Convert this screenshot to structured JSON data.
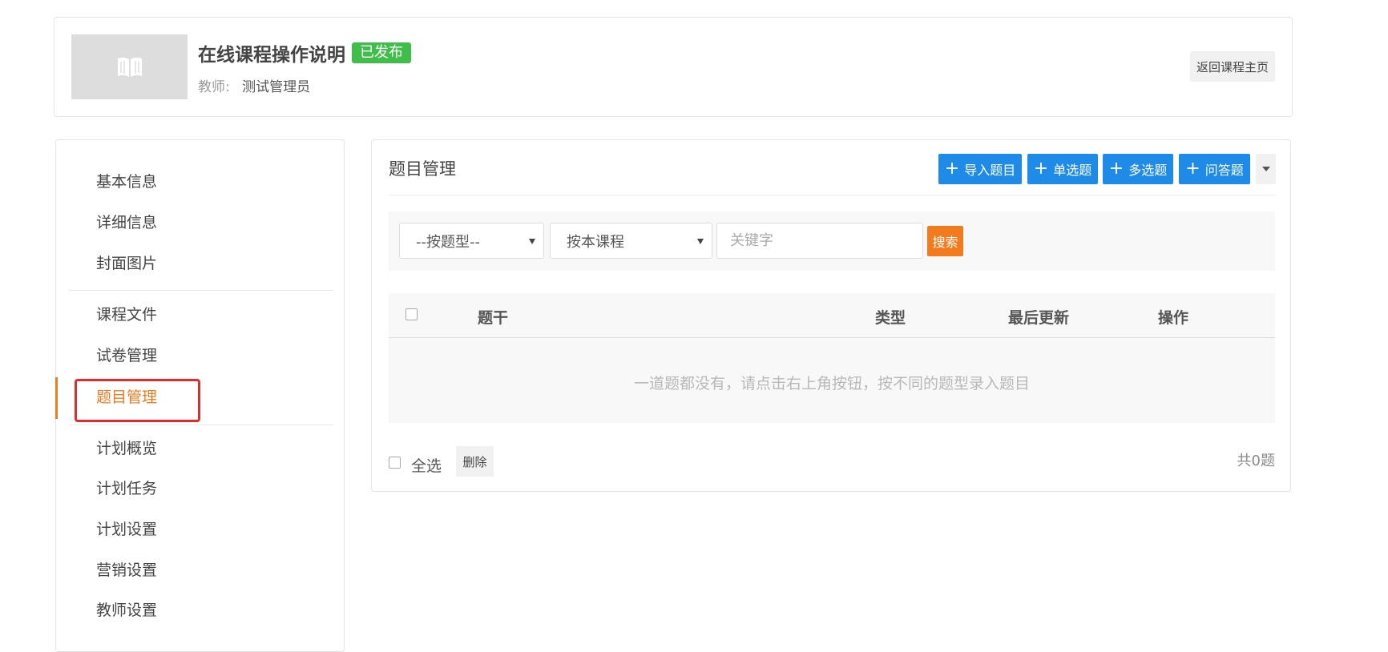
{
  "course": {
    "title": "在线课程操作说明",
    "status_badge": "已发布",
    "teacher_label": "教师:",
    "teacher_name": "测试管理员",
    "back_button": "返回课程主页",
    "cover_icon": "book-icon"
  },
  "sidebar": {
    "items": [
      {
        "label": "基本信息"
      },
      {
        "label": "详细信息"
      },
      {
        "label": "封面图片"
      },
      {
        "label": "课程文件"
      },
      {
        "label": "试卷管理"
      },
      {
        "label": "题目管理"
      },
      {
        "label": "计划概览"
      },
      {
        "label": "计划任务"
      },
      {
        "label": "计划设置"
      },
      {
        "label": "营销设置"
      },
      {
        "label": "教师设置"
      }
    ],
    "active_label": "题目管理",
    "active_color": "#f37b1d",
    "highlight_color": "#e52a2a"
  },
  "panel": {
    "title": "题目管理",
    "buttons": {
      "import": "导入题目",
      "single": "单选题",
      "multiple": "多选题",
      "essay": "问答题"
    },
    "accent_color": "#1f8be8"
  },
  "filter": {
    "type_select": "--按题型--",
    "course_select": "按本课程",
    "keyword_placeholder": "关键字",
    "search_button": "搜索",
    "search_color": "#f37b1d"
  },
  "table": {
    "columns": {
      "stem": "题干",
      "type": "类型",
      "updated": "最后更新",
      "actions": "操作"
    },
    "empty_message": "一道题都没有，请点击右上角按钮，按不同的题型录入题目"
  },
  "footer": {
    "select_all": "全选",
    "delete_button": "删除",
    "total": "共0题"
  }
}
